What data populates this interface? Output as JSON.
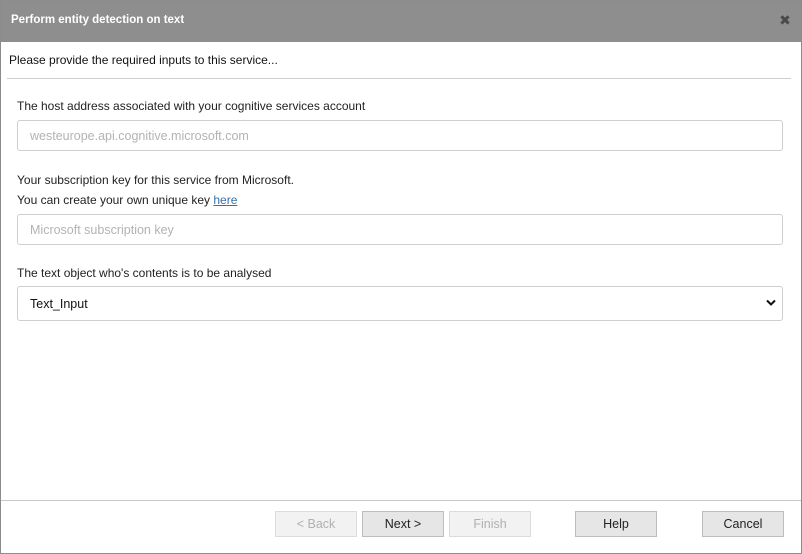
{
  "dialog": {
    "title": "Perform entity detection on text",
    "close_glyph": "✖",
    "subheader": "Please provide the required inputs to this service..."
  },
  "fields": {
    "host": {
      "label": "The host address associated with your cognitive services account",
      "placeholder": "westeurope.api.cognitive.microsoft.com",
      "value": ""
    },
    "key": {
      "label_line1": "Your subscription key for this service from Microsoft.",
      "label_line2_prefix": "You can create your own unique key ",
      "link_text": "here",
      "placeholder": "Microsoft subscription key",
      "value": ""
    },
    "text_object": {
      "label": "The text object who's contents is to be analysed",
      "selected": "Text_Input"
    }
  },
  "buttons": {
    "back": {
      "label": "< Back",
      "enabled": false
    },
    "next": {
      "label": "Next >",
      "enabled": true
    },
    "finish": {
      "label": "Finish",
      "enabled": false
    },
    "help": {
      "label": "Help",
      "enabled": true
    },
    "cancel": {
      "label": "Cancel",
      "enabled": true
    }
  },
  "icons": {
    "close": "close-icon",
    "dropdown": "chevron-down-icon"
  }
}
